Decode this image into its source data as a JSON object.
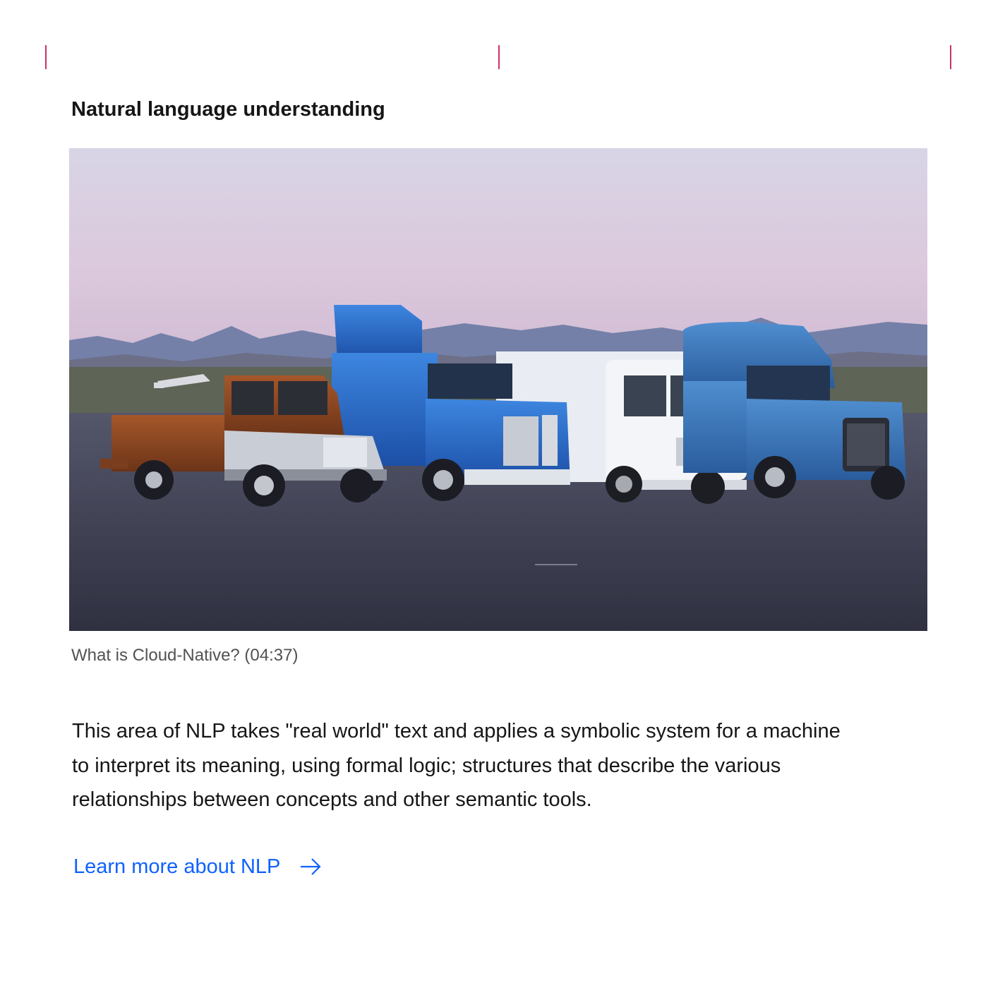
{
  "section": {
    "title": "Natural language understanding"
  },
  "video": {
    "thumbnail_alt": "Freightliner trucks lined up in a desert parking lot at dusk",
    "caption": "What is Cloud-Native? (04:37)"
  },
  "body": {
    "paragraph": "This area of NLP takes \"real world\" text and applies a symbolic system for a machine to interpret its meaning, using formal logic; structures that describe the various relationships between concepts and other semantic tools."
  },
  "cta": {
    "label": "Learn more about NLP",
    "icon": "arrow-right-icon"
  },
  "colors": {
    "accent_ticks": "#c8326b",
    "link": "#0f62fe",
    "text": "#161616",
    "caption": "#525252"
  }
}
